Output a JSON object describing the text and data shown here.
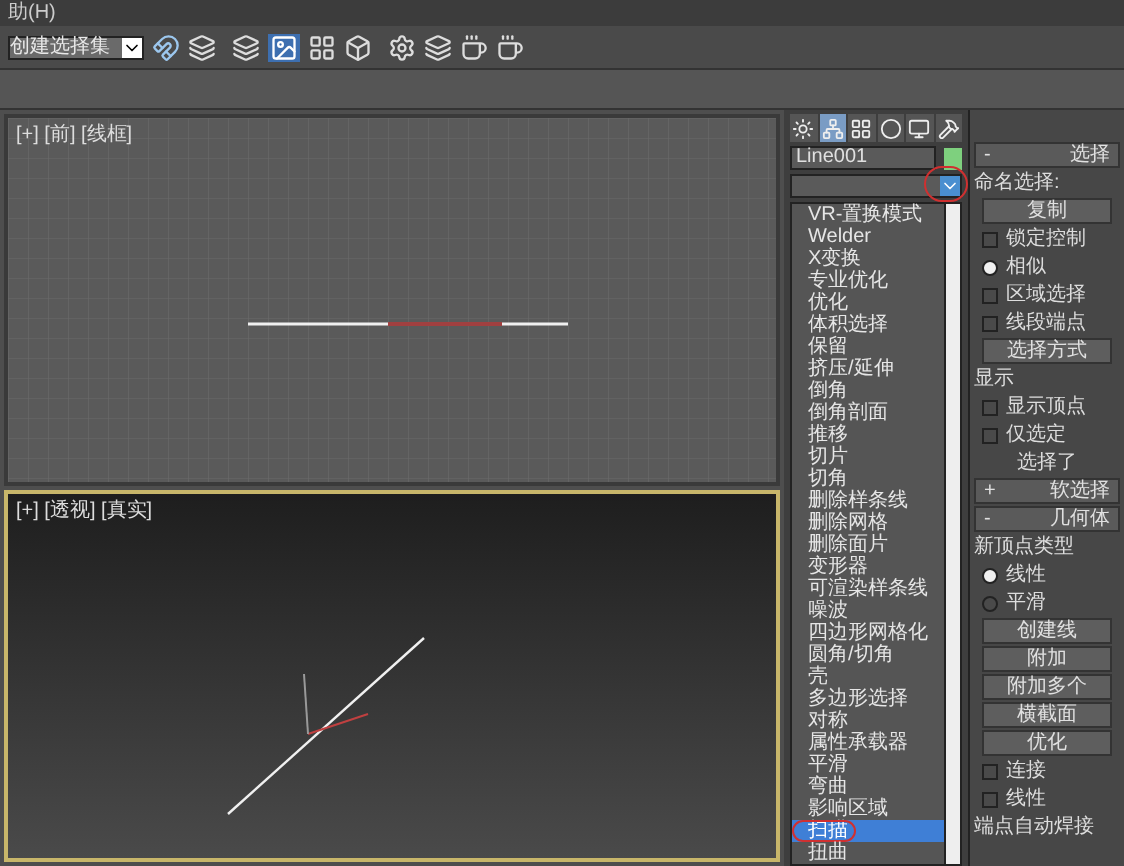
{
  "menu_bar": {
    "items": [
      "助(H)"
    ]
  },
  "toolbar": {
    "selection_set": {
      "placeholder": "创建选择集"
    }
  },
  "viewports": [
    {
      "label": "[+] [前] [线框]",
      "active": false
    },
    {
      "label": "[+] [透视] [真实]",
      "active": true
    }
  ],
  "command_panel": {
    "tabs": [
      {
        "kind": "create",
        "selected": false
      },
      {
        "kind": "modify",
        "selected": true
      },
      {
        "kind": "hierarchy",
        "selected": false
      },
      {
        "kind": "motion",
        "selected": false
      },
      {
        "kind": "display",
        "selected": false
      },
      {
        "kind": "utilities",
        "selected": false
      }
    ],
    "object_name": "Line001",
    "modifier_list": {
      "expanded": true,
      "items": [
        {
          "label": "VR-置换模式",
          "selected": false
        },
        {
          "label": "Welder",
          "selected": false
        },
        {
          "label": "X变换",
          "selected": false
        },
        {
          "label": "专业优化",
          "selected": false
        },
        {
          "label": "优化",
          "selected": false
        },
        {
          "label": "体积选择",
          "selected": false
        },
        {
          "label": "保留",
          "selected": false
        },
        {
          "label": "挤压/延伸",
          "selected": false
        },
        {
          "label": "倒角",
          "selected": false
        },
        {
          "label": "倒角剖面",
          "selected": false
        },
        {
          "label": "推移",
          "selected": false
        },
        {
          "label": "切片",
          "selected": false
        },
        {
          "label": "切角",
          "selected": false
        },
        {
          "label": "删除样条线",
          "selected": false
        },
        {
          "label": "删除网格",
          "selected": false
        },
        {
          "label": "删除面片",
          "selected": false
        },
        {
          "label": "变形器",
          "selected": false
        },
        {
          "label": "可渲染样条线",
          "selected": false
        },
        {
          "label": "噪波",
          "selected": false
        },
        {
          "label": "四边形网格化",
          "selected": false
        },
        {
          "label": "圆角/切角",
          "selected": false
        },
        {
          "label": "壳",
          "selected": false
        },
        {
          "label": "多边形选择",
          "selected": false
        },
        {
          "label": "对称",
          "selected": false
        },
        {
          "label": "属性承载器",
          "selected": false
        },
        {
          "label": "平滑",
          "selected": false
        },
        {
          "label": "弯曲",
          "selected": false
        },
        {
          "label": "影响区域",
          "selected": false
        },
        {
          "label": "扫描",
          "selected": true
        },
        {
          "label": "扭曲",
          "selected": false
        }
      ]
    }
  },
  "rollouts": [
    {
      "kind": "header",
      "label": "选择",
      "sign": "-"
    },
    {
      "kind": "group",
      "label": "命名选择:"
    },
    {
      "kind": "button",
      "label": "复制"
    },
    {
      "kind": "checkbox",
      "label": "锁定控制",
      "checked": false
    },
    {
      "kind": "radio",
      "label": "相似",
      "selected": true
    },
    {
      "kind": "checkbox",
      "label": "区域选择",
      "checked": false
    },
    {
      "kind": "checkbox",
      "label": "线段端点",
      "checked": false
    },
    {
      "kind": "button",
      "label": "选择方式"
    },
    {
      "kind": "group",
      "label": "显示"
    },
    {
      "kind": "checkbox",
      "label": "显示顶点",
      "checked": false
    },
    {
      "kind": "checkbox",
      "label": "仅选定",
      "checked": false
    },
    {
      "kind": "text",
      "label": "选择了"
    },
    {
      "kind": "header",
      "label": "软选择",
      "sign": "+"
    },
    {
      "kind": "header",
      "label": "几何体",
      "sign": "-"
    },
    {
      "kind": "group",
      "label": "新顶点类型"
    },
    {
      "kind": "radio",
      "label": "线性",
      "selected": true
    },
    {
      "kind": "radio",
      "label": "平滑",
      "selected": false
    },
    {
      "kind": "button",
      "label": "创建线"
    },
    {
      "kind": "button",
      "label": "附加"
    },
    {
      "kind": "button",
      "label": "附加多个"
    },
    {
      "kind": "button",
      "label": "横截面"
    },
    {
      "kind": "button",
      "label": "优化"
    },
    {
      "kind": "checkbox",
      "label": "连接",
      "checked": false
    },
    {
      "kind": "checkbox",
      "label": "线性",
      "checked": false
    },
    {
      "kind": "group",
      "label": "端点自动焊接"
    }
  ]
}
